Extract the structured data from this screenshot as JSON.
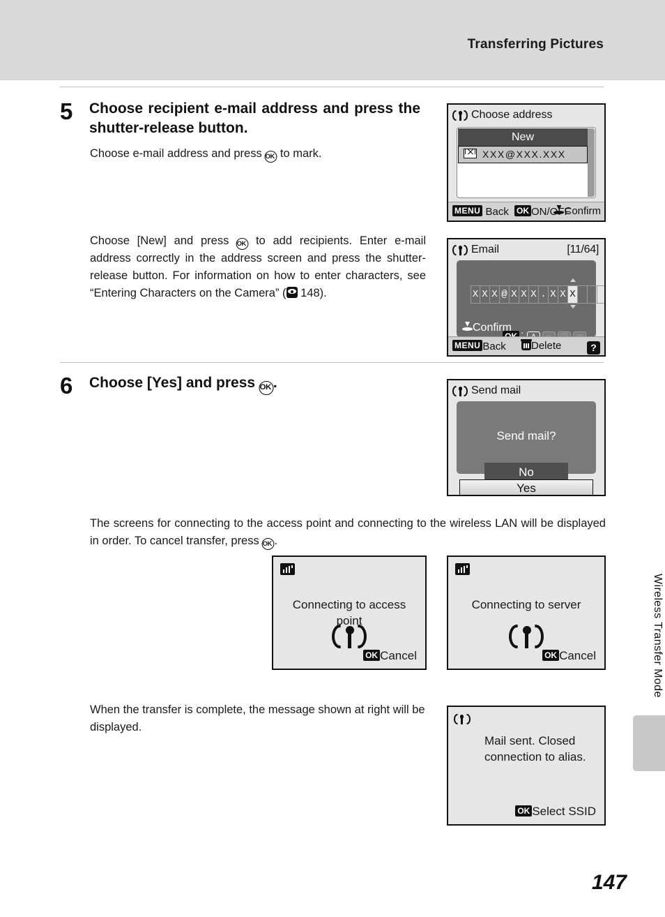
{
  "header": {
    "title": "Transferring Pictures"
  },
  "side_tab": {
    "label": "Wireless Transfer Mode"
  },
  "page_number": "147",
  "steps": [
    {
      "number": "5",
      "title": "Choose recipient e-mail address and press the shutter-release button.",
      "body_1_before": "Choose e-mail address and press ",
      "body_1_after": " to mark.",
      "body_2_a": "Choose [New] and press ",
      "body_2_b": " to add recipients. Enter e-mail address correctly in the address screen and press the shutter-release button. For information on how to enter characters, see “Entering Characters on the Camera” (",
      "body_2_page": " 148)."
    },
    {
      "number": "6",
      "title_before": "Choose [Yes] and press ",
      "title_after": "."
    }
  ],
  "paragraphs": {
    "transfer_note_a": "The screens for connecting to the access point and connecting to the wireless LAN will be displayed in order. To cancel transfer, press ",
    "transfer_note_b": ".",
    "complete_note": "When the transfer is complete, the message shown at right will be displayed."
  },
  "screens": {
    "choose_address": {
      "title": "Choose address",
      "new_label": "New",
      "address": "XXX@XXX.XXX",
      "bar": {
        "menu_key": "MENU",
        "back": "Back",
        "ok_key": "OK",
        "onoff": "ON/OFF",
        "confirm": "Confirm"
      }
    },
    "email": {
      "title": "Email",
      "counter": "[11/64]",
      "value": "XXX@XXX.XXX",
      "cells_total": 17,
      "cursor_index": 10,
      "ok_key": "OK",
      "modes": [
        "A",
        "a",
        "囯",
        "@"
      ],
      "selected_mode": "A",
      "confirm": "Confirm",
      "bar": {
        "menu_key": "MENU",
        "back": "Back",
        "delete": "Delete",
        "help": "?"
      }
    },
    "send_mail": {
      "title": "Send mail",
      "question": "Send mail?",
      "no": "No",
      "yes": "Yes"
    },
    "connect_ap": {
      "message": "Connecting to access point",
      "ok_key": "OK",
      "action": "Cancel"
    },
    "connect_server": {
      "message": "Connecting to server",
      "ok_key": "OK",
      "action": "Cancel"
    },
    "mail_sent": {
      "message": "Mail sent. Closed connection to alias.",
      "ok_key": "OK",
      "action": "Select SSID"
    }
  },
  "icons": {
    "wireless": "wireless-antenna-icon",
    "signal": "signal-bars-icon",
    "mail": "envelope-check-icon",
    "shutter": "shutter-press-icon",
    "trash": "trash-icon",
    "ok_button": "ok-button-icon",
    "see_page": "see-page-icon"
  },
  "colors": {
    "header_bg": "#d9d9d9",
    "tab_bg": "#c8c8c8",
    "lcd_bg": "#e6e6e6",
    "lcd_panel": "#6b6b6b"
  }
}
